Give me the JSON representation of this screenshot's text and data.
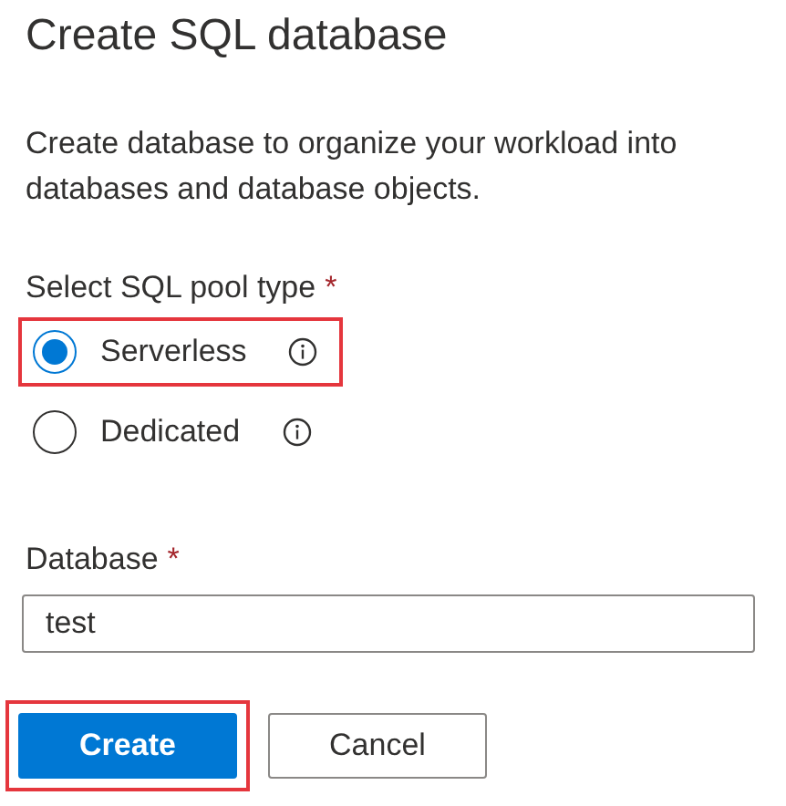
{
  "title": "Create SQL database",
  "description": "Create database to organize your workload into databases and database objects.",
  "pool_type": {
    "label": "Select SQL pool type",
    "required_mark": "*",
    "options": [
      {
        "label": "Serverless",
        "selected": true,
        "highlighted": true
      },
      {
        "label": "Dedicated",
        "selected": false,
        "highlighted": false
      }
    ]
  },
  "database": {
    "label": "Database",
    "required_mark": "*",
    "value": "test"
  },
  "buttons": [
    {
      "label": "Create",
      "kind": "primary",
      "highlighted": true
    },
    {
      "label": "Cancel",
      "kind": "secondary",
      "highlighted": false
    }
  ]
}
